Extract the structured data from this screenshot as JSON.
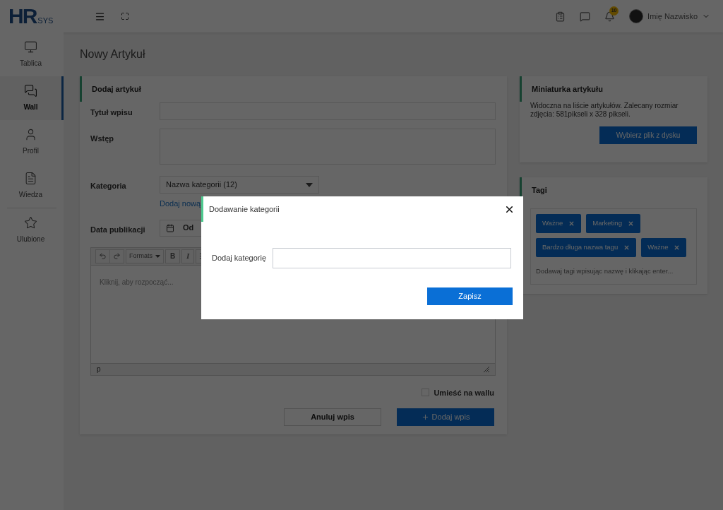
{
  "header": {
    "logo_main": "HR",
    "logo_sub": "SYS",
    "notifications_count": "10",
    "user_name": "Imię Nazwisko"
  },
  "sidebar": {
    "items": [
      {
        "label": "Tablica",
        "selected": false
      },
      {
        "label": "Wall",
        "selected": true
      },
      {
        "label": "Profil",
        "selected": false
      },
      {
        "label": "Wiedza",
        "selected": false
      },
      {
        "label": "Ulubione",
        "selected": false,
        "divider_before": true
      }
    ]
  },
  "page_title": "Nowy Artykuł",
  "article_form": {
    "title": "Dodaj artykuł",
    "fields": [
      {
        "kind": "input",
        "label": "Tytuł wpisu"
      },
      {
        "kind": "textarea",
        "label": "Wstęp"
      },
      {
        "kind": "select",
        "label": "Kategoria",
        "value": "Nazwa kategorii (12)",
        "link": "Dodaj nową"
      },
      {
        "kind": "date",
        "label": "Data publikacji",
        "value": "Od"
      }
    ],
    "editor": {
      "toolbar": [
        {
          "kind": "undo"
        },
        {
          "kind": "redo"
        },
        {
          "kind": "dropdown",
          "label": "Formats"
        },
        {
          "kind": "text",
          "label": "B"
        },
        {
          "kind": "italic",
          "label": "I"
        },
        {
          "kind": "align"
        }
      ],
      "placeholder": "Kliknij, aby rozpocząć...",
      "status": "p"
    },
    "wall_checkbox": {
      "label": "Umieść na wallu",
      "checked": false
    },
    "cancel_button": "Anuluj wpis",
    "submit_button": "Dodaj wpis"
  },
  "thumbnail_card": {
    "title": "Miniaturka artykułu",
    "description": "Widoczna na liście artykułów. Zalecany rozmiar zdjęcia: 581pikseli x 328 pikseli.",
    "button": "Wybierz plik z dysku"
  },
  "tags_card": {
    "title": "Tagi",
    "tags": [
      "Ważne",
      "Marketing",
      "Bardzo długa nazwa tagu",
      "Ważne"
    ],
    "placeholder": "Dodawaj tagi wpisując nazwę i klikając enter..."
  },
  "modal": {
    "title": "Dodawanie kategorii",
    "field_label": "Dodaj kategorię",
    "save_button": "Zapisz"
  }
}
